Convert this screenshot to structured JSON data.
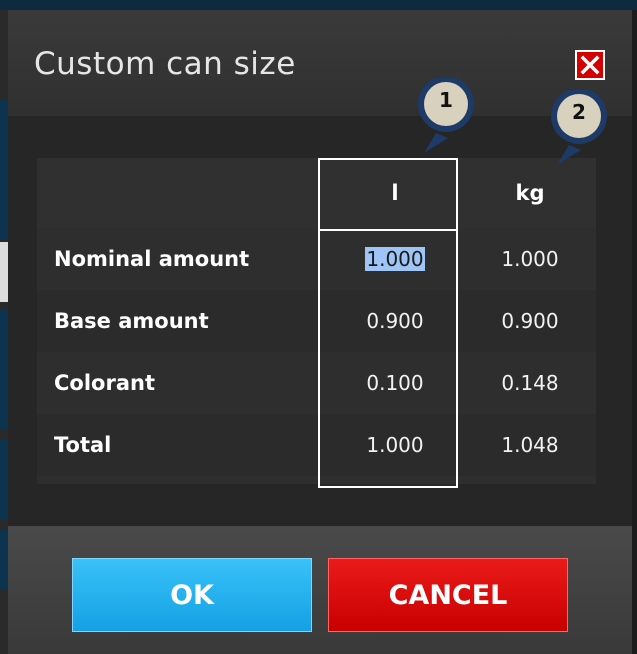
{
  "dialog": {
    "title": "Custom can size",
    "close_icon": "close-x-icon"
  },
  "table": {
    "columns": [
      "l",
      "kg"
    ],
    "rows": [
      {
        "label": "Nominal amount",
        "l": "1.000",
        "kg": "1.000"
      },
      {
        "label": "Base amount",
        "l": "0.900",
        "kg": "0.900"
      },
      {
        "label": "Colorant",
        "l": "0.100",
        "kg": "0.148"
      },
      {
        "label": "Total",
        "l": "1.000",
        "kg": "1.048"
      }
    ]
  },
  "buttons": {
    "ok_label": "OK",
    "cancel_label": "CANCEL"
  },
  "callouts": [
    {
      "number": "1"
    },
    {
      "number": "2"
    }
  ],
  "colors": {
    "ok": "#1eaef0",
    "cancel": "#d80000",
    "close": "#d40000",
    "selection": "#9ec5f5"
  }
}
